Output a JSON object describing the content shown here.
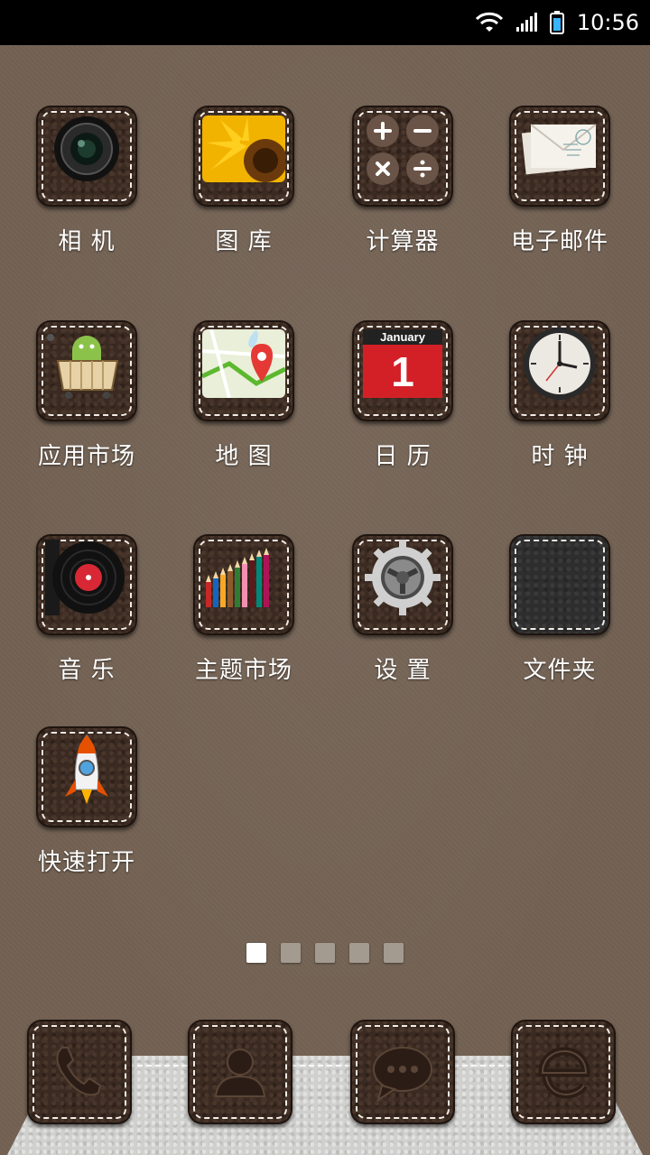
{
  "status_bar": {
    "time": "10:56"
  },
  "apps": [
    {
      "label": "相 机",
      "icon": "camera-icon"
    },
    {
      "label": "图 库",
      "icon": "gallery-icon"
    },
    {
      "label": "计算器",
      "icon": "calculator-icon"
    },
    {
      "label": "电子邮件",
      "icon": "email-icon"
    },
    {
      "label": "应用市场",
      "icon": "app-market-icon"
    },
    {
      "label": "地 图",
      "icon": "map-icon"
    },
    {
      "label": "日 历",
      "icon": "calendar-icon",
      "calendar_month": "January",
      "calendar_day": "1"
    },
    {
      "label": "时 钟",
      "icon": "clock-icon"
    },
    {
      "label": "音 乐",
      "icon": "music-icon"
    },
    {
      "label": "主题市场",
      "icon": "theme-market-icon"
    },
    {
      "label": "设 置",
      "icon": "settings-icon"
    },
    {
      "label": "文件夹",
      "icon": "folder-icon"
    },
    {
      "label": "快速打开",
      "icon": "rocket-icon"
    }
  ],
  "page_indicator": {
    "count": 5,
    "active": 0
  },
  "dock": [
    {
      "icon": "phone-icon"
    },
    {
      "icon": "contacts-icon"
    },
    {
      "icon": "messages-icon"
    },
    {
      "icon": "browser-icon"
    }
  ],
  "colors": {
    "wallpaper": "#736253",
    "tile": "#3a2a21",
    "stitch": "#f2ede6",
    "label": "#ffffff"
  }
}
